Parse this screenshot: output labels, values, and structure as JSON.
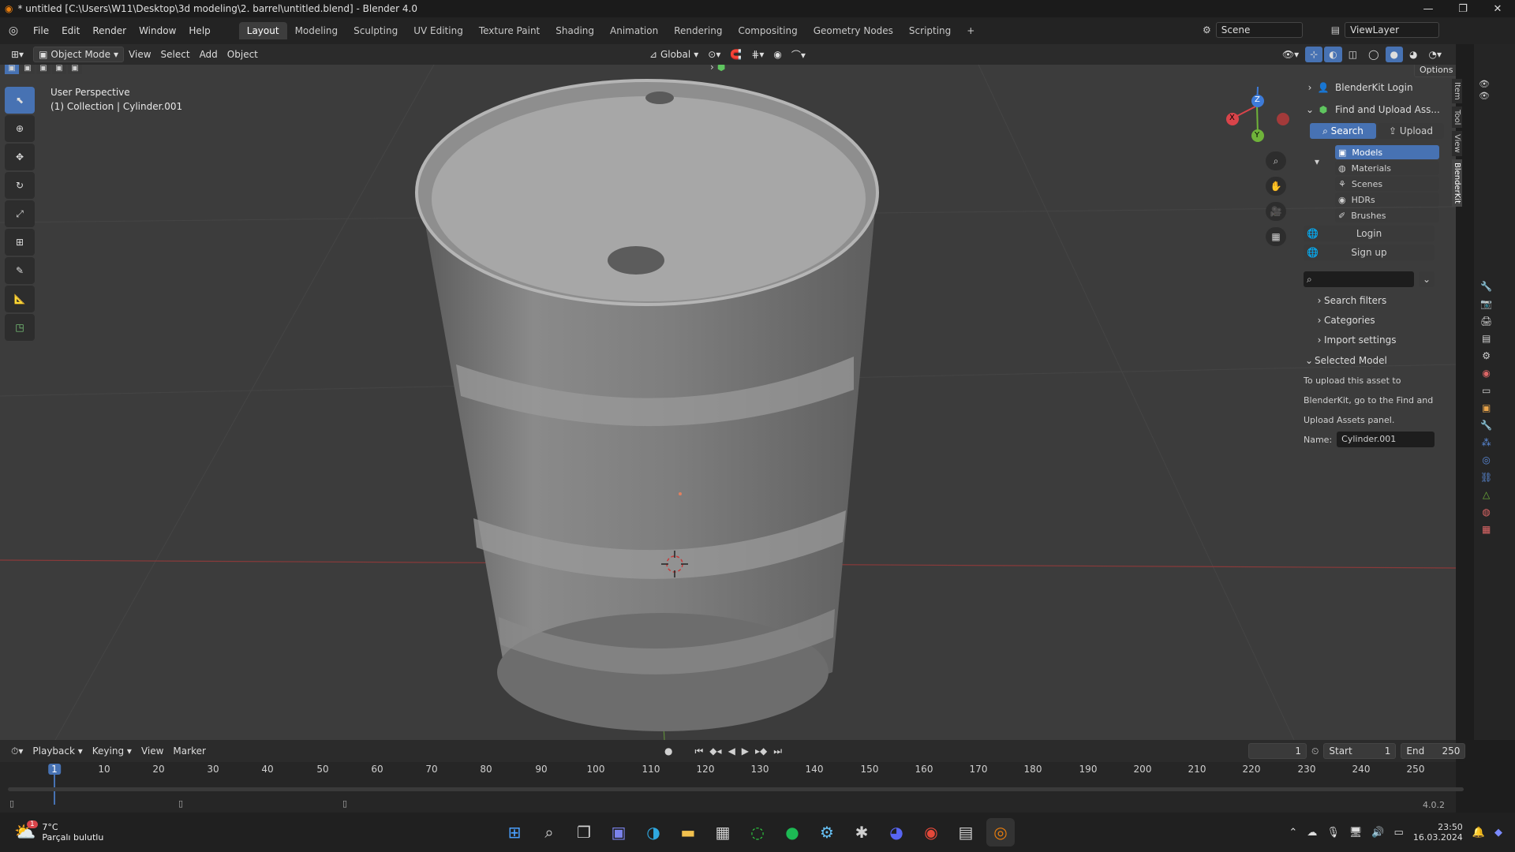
{
  "window": {
    "title": "* untitled [C:\\Users\\W11\\Desktop\\3d modeling\\2. barrel\\untitled.blend] - Blender 4.0"
  },
  "menu": [
    "File",
    "Edit",
    "Render",
    "Window",
    "Help"
  ],
  "workspaces": [
    "Layout",
    "Modeling",
    "Sculpting",
    "UV Editing",
    "Texture Paint",
    "Shading",
    "Animation",
    "Rendering",
    "Compositing",
    "Geometry Nodes",
    "Scripting"
  ],
  "scene": {
    "name": "Scene",
    "view_layer": "ViewLayer"
  },
  "header": {
    "mode": "Object Mode",
    "view": "View",
    "select": "Select",
    "add": "Add",
    "object": "Object",
    "orientation": "Global",
    "options": "Options"
  },
  "viewport": {
    "perspective": "User Perspective",
    "collection": "(1) Collection | Cylinder.001",
    "gizmo": {
      "x": "X",
      "y": "Y",
      "z": "Z"
    }
  },
  "npanel": {
    "login_header": "BlenderKit Login",
    "find_upload": "Find and Upload Ass...",
    "search_tab": "Search",
    "upload_tab": "Upload",
    "asset_types": [
      "Models",
      "Materials",
      "Scenes",
      "HDRs",
      "Brushes"
    ],
    "login_btn": "Login",
    "signup_btn": "Sign up",
    "search_placeholder": "",
    "search_filters": "Search filters",
    "categories": "Categories",
    "import_settings": "Import settings",
    "selected_model": "Selected Model",
    "info_line1": "To upload this asset to",
    "info_line2": "BlenderKit, go to the Find and",
    "info_line3": "Upload Assets panel.",
    "name_label": "Name:",
    "name_value": "Cylinder.001"
  },
  "sidetabs": [
    "Item",
    "Tool",
    "View",
    "BlenderKit"
  ],
  "timeline": {
    "playback": "Playback",
    "keying": "Keying",
    "view": "View",
    "marker": "Marker",
    "current_frame": "1",
    "start_label": "Start",
    "start": "1",
    "end_label": "End",
    "end": "250",
    "ruler": [
      "1",
      "10",
      "20",
      "30",
      "40",
      "50",
      "60",
      "70",
      "80",
      "90",
      "100",
      "110",
      "120",
      "130",
      "140",
      "150",
      "160",
      "170",
      "180",
      "190",
      "200",
      "210",
      "220",
      "230",
      "240",
      "250"
    ]
  },
  "status": {
    "version": "4.0.2"
  },
  "taskbar": {
    "weather_temp": "7°C",
    "weather_desc": "Parçalı bulutlu",
    "time": "23:50",
    "date": "16.03.2024",
    "badge": "1"
  }
}
